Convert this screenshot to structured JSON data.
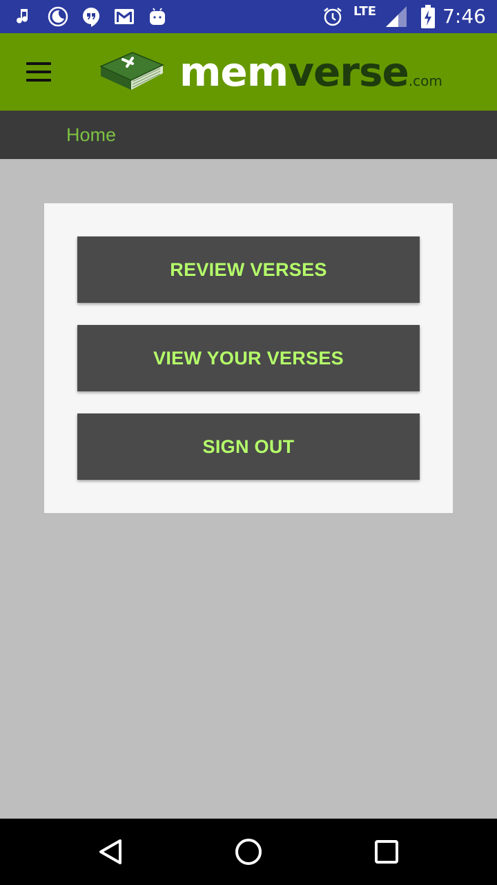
{
  "status_bar": {
    "network": "LTE",
    "time": "7:46",
    "icons": [
      "music-note-icon",
      "moon-icon",
      "hangouts-icon",
      "gmail-icon",
      "android-icon",
      "alarm-icon",
      "signal-icon",
      "battery-charging-icon"
    ]
  },
  "header": {
    "menu_icon": "hamburger-menu-icon",
    "logo": {
      "part1": "mem",
      "part2": "verse",
      "suffix": ".com",
      "icon": "book-cross-icon"
    }
  },
  "breadcrumb": {
    "home": "Home"
  },
  "actions": [
    {
      "label": "REVIEW VERSES"
    },
    {
      "label": "VIEW YOUR VERSES"
    },
    {
      "label": "SIGN OUT"
    }
  ],
  "nav": {
    "icons": [
      "back-icon",
      "home-icon",
      "recents-icon"
    ]
  },
  "colors": {
    "status_bar": "#2b3a9e",
    "header": "#669900",
    "breadcrumb_bar": "#3a3a3a",
    "accent_green": "#7dc243",
    "button_bg": "#4a4a4a",
    "button_text": "#b5ff6a",
    "page_bg": "#bebebe"
  }
}
